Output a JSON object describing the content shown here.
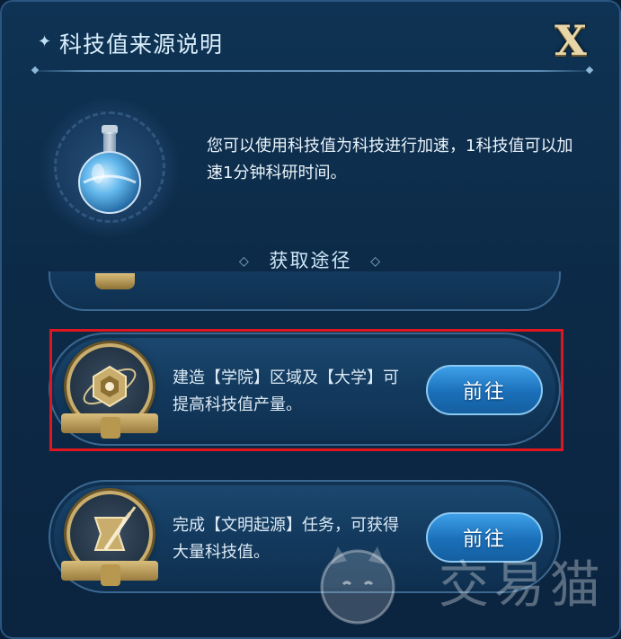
{
  "header": {
    "title": "科技值来源说明",
    "close_label": "X"
  },
  "intro": {
    "text": "您可以使用科技值为科技进行加速，1科技值可以加速1分钟科研时间。"
  },
  "section": {
    "title": "获取途径"
  },
  "cards": [
    {
      "desc": "建造【学院】区域及【大学】可提高科技值产量。",
      "button": "前往",
      "icon": "atom-hexagon-icon"
    },
    {
      "desc": "完成【文明起源】任务，可获得大量科技值。",
      "button": "前往",
      "icon": "scroll-quill-icon"
    }
  ],
  "watermark": {
    "text": "交易猫"
  },
  "colors": {
    "panel": "#0f3354",
    "button": "#1a6fb8",
    "gold": "#c9ad6d",
    "highlight": "#e0161e"
  }
}
